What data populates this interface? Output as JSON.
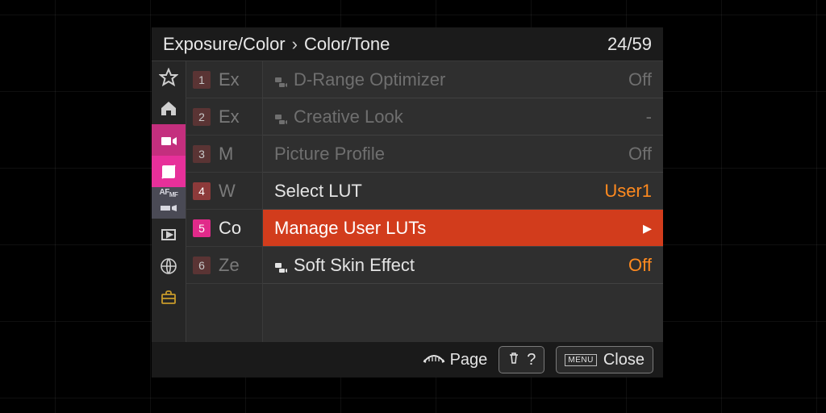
{
  "header": {
    "crumb_parent": "Exposure/Color",
    "crumb_current": "Color/Tone",
    "page_counter": "24/59"
  },
  "tabs": {
    "names": [
      "star",
      "home",
      "video",
      "exposure",
      "afmf",
      "playback",
      "network",
      "briefcase"
    ]
  },
  "subnav": [
    {
      "num": "1",
      "label": "Ex",
      "active": false,
      "dim": true
    },
    {
      "num": "2",
      "label": "Ex",
      "active": false,
      "dim": true
    },
    {
      "num": "3",
      "label": "M",
      "active": false,
      "dim": true
    },
    {
      "num": "4",
      "label": "W",
      "active": false,
      "dim": false
    },
    {
      "num": "5",
      "label": "Co",
      "active": true,
      "dim": false
    },
    {
      "num": "6",
      "label": "Ze",
      "active": false,
      "dim": true
    }
  ],
  "rows": [
    {
      "icon": true,
      "label": "D-Range Optimizer",
      "value": "Off",
      "valueClass": "",
      "state": "disabled"
    },
    {
      "icon": true,
      "label": "Creative Look",
      "value": "-",
      "valueClass": "",
      "state": "disabled"
    },
    {
      "icon": false,
      "label": "Picture Profile",
      "value": "Off",
      "valueClass": "",
      "state": "disabled"
    },
    {
      "icon": false,
      "label": "Select LUT",
      "value": "User1",
      "valueClass": "orange",
      "state": "normal"
    },
    {
      "icon": false,
      "label": "Manage User LUTs",
      "value": "",
      "valueClass": "",
      "state": "highlight",
      "arrow": true
    },
    {
      "icon": true,
      "label": "Soft Skin Effect",
      "value": "Off",
      "valueClass": "orange",
      "state": "normal"
    }
  ],
  "footer": {
    "page_label": "Page",
    "help_label": "?",
    "close_small": "MENU",
    "close_label": "Close"
  }
}
